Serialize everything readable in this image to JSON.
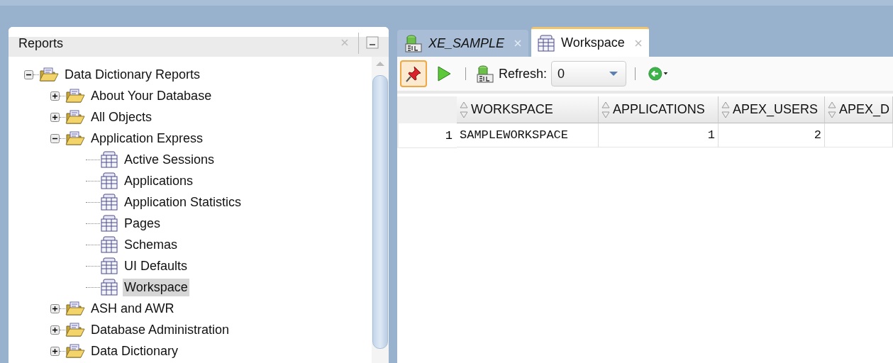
{
  "left_panel": {
    "title": "Reports",
    "tree": [
      {
        "label": "Data Dictionary Reports",
        "kind": "folder",
        "expanded": true,
        "selected": false,
        "children": [
          {
            "label": "About Your Database",
            "kind": "folder",
            "expanded": false,
            "selected": false
          },
          {
            "label": "All Objects",
            "kind": "folder",
            "expanded": false,
            "selected": false
          },
          {
            "label": "Application Express",
            "kind": "folder",
            "expanded": true,
            "selected": false,
            "children": [
              {
                "label": "Active Sessions",
                "kind": "report",
                "selected": false
              },
              {
                "label": "Applications",
                "kind": "report",
                "selected": false
              },
              {
                "label": "Application Statistics",
                "kind": "report",
                "selected": false
              },
              {
                "label": "Pages",
                "kind": "report",
                "selected": false
              },
              {
                "label": "Schemas",
                "kind": "report",
                "selected": false
              },
              {
                "label": "UI Defaults",
                "kind": "report",
                "selected": false
              },
              {
                "label": "Workspace",
                "kind": "report",
                "selected": true
              }
            ]
          },
          {
            "label": "ASH and AWR",
            "kind": "folder",
            "expanded": false,
            "selected": false
          },
          {
            "label": "Database Administration",
            "kind": "folder",
            "expanded": false,
            "selected": false
          },
          {
            "label": "Data Dictionary",
            "kind": "folder",
            "expanded": false,
            "selected": false
          }
        ]
      }
    ]
  },
  "editor_tabs": [
    {
      "label": "XE_SAMPLE",
      "kind": "sql",
      "selected": false
    },
    {
      "label": "Workspace",
      "kind": "report",
      "selected": true
    }
  ],
  "toolbar": {
    "pinned": true,
    "refresh_label": "Refresh:",
    "refresh_value": "0"
  },
  "grid": {
    "columns": [
      {
        "label": "WORKSPACE",
        "kind": "text"
      },
      {
        "label": "APPLICATIONS",
        "kind": "number"
      },
      {
        "label": "APEX_USERS",
        "kind": "number"
      },
      {
        "label": "APEX_D",
        "kind": "number"
      }
    ],
    "rows": [
      {
        "number": "1",
        "cells": [
          "SAMPLEWORKSPACE",
          "1",
          "2"
        ]
      }
    ]
  }
}
